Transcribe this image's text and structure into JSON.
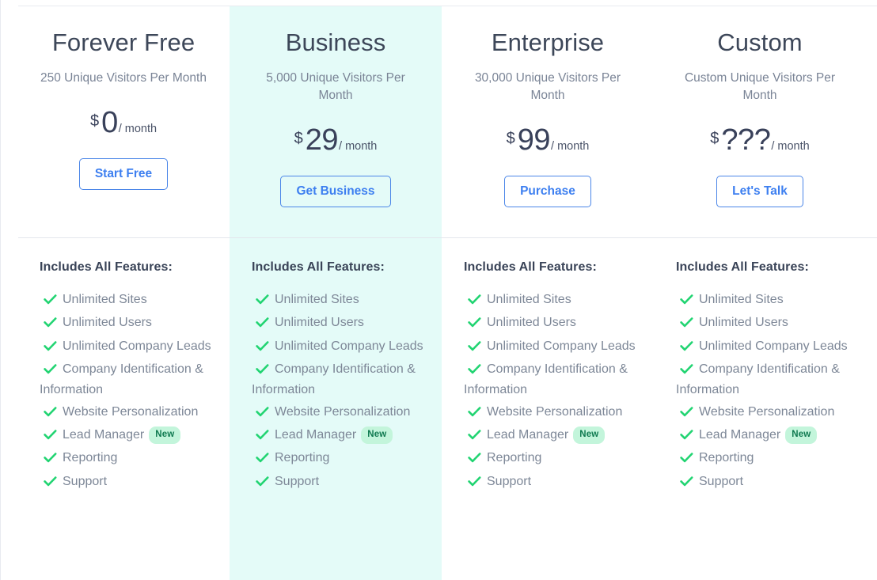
{
  "colors": {
    "highlight_background": "#e4fbf8",
    "check_green": "#22d472",
    "cta_blue": "#3d7ff0",
    "badge_background": "#c3f5db",
    "badge_text": "#107a50",
    "heading": "#3d4759",
    "muted_text": "#7a8496",
    "rule": "#e8eaf0"
  },
  "features_heading": "Includes All Features:",
  "badge_new_label": "New",
  "price_period_label": "/ month",
  "currency_symbol": "$",
  "features": [
    {
      "label": "Unlimited Sites",
      "badge": ""
    },
    {
      "label": "Unlimited Users",
      "badge": ""
    },
    {
      "label": "Unlimited Company Leads",
      "badge": ""
    },
    {
      "label": "Company Identification & Information",
      "badge": ""
    },
    {
      "label": "Website Personalization",
      "badge": ""
    },
    {
      "label": "Lead Manager",
      "badge": "New"
    },
    {
      "label": "Reporting",
      "badge": ""
    },
    {
      "label": "Support",
      "badge": ""
    }
  ],
  "plans": [
    {
      "name": "Forever Free",
      "subtitle": "250 Unique Visitors Per Month",
      "visitors": "250",
      "price_amount": "0",
      "price_currency": "$",
      "price_period": "/ month",
      "cta_label": "Start Free",
      "highlighted": false,
      "features_heading": "Includes All Features:"
    },
    {
      "name": "Business",
      "subtitle": "5,000 Unique Visitors Per Month",
      "visitors": "5,000",
      "price_amount": "29",
      "price_currency": "$",
      "price_period": "/ month",
      "cta_label": "Get Business",
      "highlighted": true,
      "features_heading": "Includes All Features:"
    },
    {
      "name": "Enterprise",
      "subtitle": "30,000 Unique Visitors Per Month",
      "visitors": "30,000",
      "price_amount": "99",
      "price_currency": "$",
      "price_period": "/ month",
      "cta_label": "Purchase",
      "highlighted": false,
      "features_heading": "Includes All Features:"
    },
    {
      "name": "Custom",
      "subtitle": "Custom Unique Visitors Per Month",
      "visitors": "Custom",
      "price_amount": "???",
      "price_currency": "$",
      "price_period": "/ month",
      "cta_label": "Let's Talk",
      "highlighted": false,
      "features_heading": "Includes All Features:"
    }
  ]
}
